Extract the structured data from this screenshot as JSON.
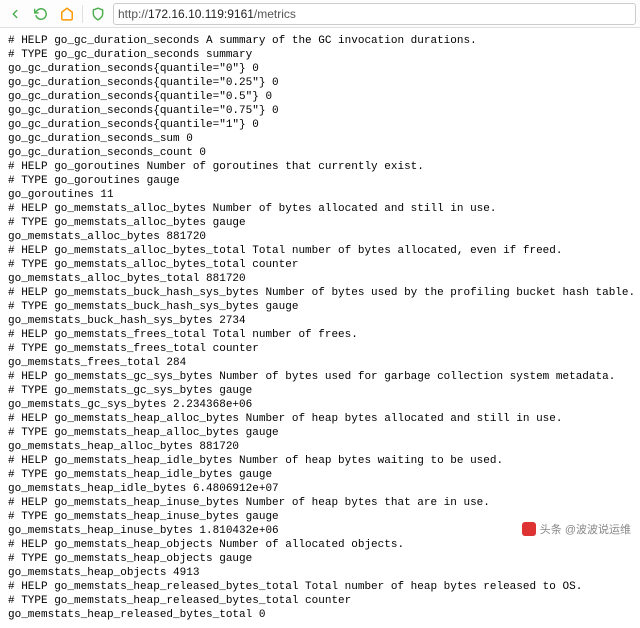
{
  "toolbar": {
    "back_icon": "back-icon",
    "refresh_icon": "refresh-icon",
    "home_icon": "home-icon",
    "shield_icon": "shield-icon"
  },
  "urlbar": {
    "scheme": "http://",
    "host": "172.16.10.119:9161",
    "path": "/metrics"
  },
  "metrics_lines": [
    "# HELP go_gc_duration_seconds A summary of the GC invocation durations.",
    "# TYPE go_gc_duration_seconds summary",
    "go_gc_duration_seconds{quantile=\"0\"} 0",
    "go_gc_duration_seconds{quantile=\"0.25\"} 0",
    "go_gc_duration_seconds{quantile=\"0.5\"} 0",
    "go_gc_duration_seconds{quantile=\"0.75\"} 0",
    "go_gc_duration_seconds{quantile=\"1\"} 0",
    "go_gc_duration_seconds_sum 0",
    "go_gc_duration_seconds_count 0",
    "# HELP go_goroutines Number of goroutines that currently exist.",
    "# TYPE go_goroutines gauge",
    "go_goroutines 11",
    "# HELP go_memstats_alloc_bytes Number of bytes allocated and still in use.",
    "# TYPE go_memstats_alloc_bytes gauge",
    "go_memstats_alloc_bytes 881720",
    "# HELP go_memstats_alloc_bytes_total Total number of bytes allocated, even if freed.",
    "# TYPE go_memstats_alloc_bytes_total counter",
    "go_memstats_alloc_bytes_total 881720",
    "# HELP go_memstats_buck_hash_sys_bytes Number of bytes used by the profiling bucket hash table.",
    "# TYPE go_memstats_buck_hash_sys_bytes gauge",
    "go_memstats_buck_hash_sys_bytes 2734",
    "# HELP go_memstats_frees_total Total number of frees.",
    "# TYPE go_memstats_frees_total counter",
    "go_memstats_frees_total 284",
    "# HELP go_memstats_gc_sys_bytes Number of bytes used for garbage collection system metadata.",
    "# TYPE go_memstats_gc_sys_bytes gauge",
    "go_memstats_gc_sys_bytes 2.234368e+06",
    "# HELP go_memstats_heap_alloc_bytes Number of heap bytes allocated and still in use.",
    "# TYPE go_memstats_heap_alloc_bytes gauge",
    "go_memstats_heap_alloc_bytes 881720",
    "# HELP go_memstats_heap_idle_bytes Number of heap bytes waiting to be used.",
    "# TYPE go_memstats_heap_idle_bytes gauge",
    "go_memstats_heap_idle_bytes 6.4806912e+07",
    "# HELP go_memstats_heap_inuse_bytes Number of heap bytes that are in use.",
    "# TYPE go_memstats_heap_inuse_bytes gauge",
    "go_memstats_heap_inuse_bytes 1.810432e+06",
    "# HELP go_memstats_heap_objects Number of allocated objects.",
    "# TYPE go_memstats_heap_objects gauge",
    "go_memstats_heap_objects 4913",
    "# HELP go_memstats_heap_released_bytes_total Total number of heap bytes released to OS.",
    "# TYPE go_memstats_heap_released_bytes_total counter",
    "go_memstats_heap_released_bytes_total 0"
  ],
  "watermark": {
    "text": "头条 @波波说运维"
  }
}
